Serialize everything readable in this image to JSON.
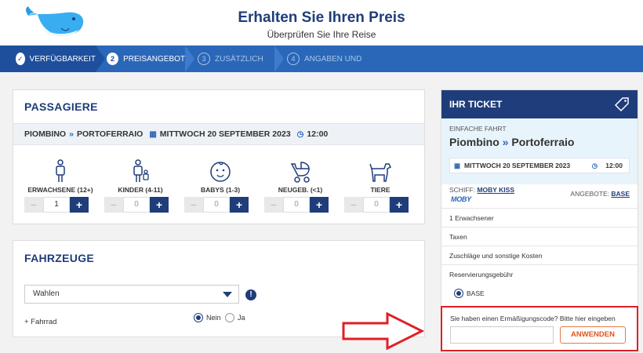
{
  "header": {
    "title": "Erhalten Sie Ihren Preis",
    "subtitle": "Überprüfen Sie Ihre Reise"
  },
  "steps": [
    {
      "num": "✓",
      "label": "Verfügbarkeit",
      "state": "done"
    },
    {
      "num": "2",
      "label": "Preisangebot",
      "state": "active"
    },
    {
      "num": "3",
      "label": "Zusätzlich",
      "state": "future"
    },
    {
      "num": "4",
      "label": "Angaben und",
      "state": "future"
    }
  ],
  "passengers": {
    "title": "PASSAGIERE",
    "route": {
      "from": "PIOMBINO",
      "to": "PORTOFERRAIO",
      "date": "MITTWOCH 20 SEPTEMBER 2023",
      "time": "12:00"
    },
    "types": [
      {
        "label": "ERWACHSENE (12+)",
        "value": "1",
        "icon": "adult-icon"
      },
      {
        "label": "KINDER (4-11)",
        "value": "0",
        "icon": "child-icon"
      },
      {
        "label": "BABYS (1-3)",
        "value": "0",
        "icon": "baby-icon"
      },
      {
        "label": "NEUGEB. (<1)",
        "value": "0",
        "icon": "stroller-icon"
      },
      {
        "label": "TIERE",
        "value": "0",
        "icon": "dog-icon"
      }
    ]
  },
  "vehicles": {
    "title": "FAHRZEUGE",
    "select_value": "Wahlen",
    "bike_label": "+ Fahrrad",
    "radio_no": "Nein",
    "radio_yes": "Ja"
  },
  "ticket": {
    "title": "IHR TICKET",
    "type": "EINFACHE FAHRT",
    "from": "Piombino",
    "to": "Portoferraio",
    "date": "MITTWOCH 20 SEPTEMBER 2023",
    "time": "12:00",
    "ship_label": "SCHIFF:",
    "ship_name": "MOBY KISS",
    "offer_label": "ANGEBOTE:",
    "offer_name": "BASE",
    "brand": "MOBY",
    "lines": [
      "1 Erwachsener",
      "Taxen",
      "Zuschläge und sonstige Kosten",
      "Reservierungsgebühr"
    ],
    "base_option": "BASE"
  },
  "promo": {
    "text": "Sie haben einen Ermäßigungscode? Bitte hier eingeben",
    "input_placeholder": "",
    "button": "ANWENDEN"
  },
  "colors": {
    "brand_dark": "#1f3d7a",
    "brand_blue": "#2a67b8",
    "highlight_red": "#e01f26",
    "accent_orange": "#e0541f"
  }
}
